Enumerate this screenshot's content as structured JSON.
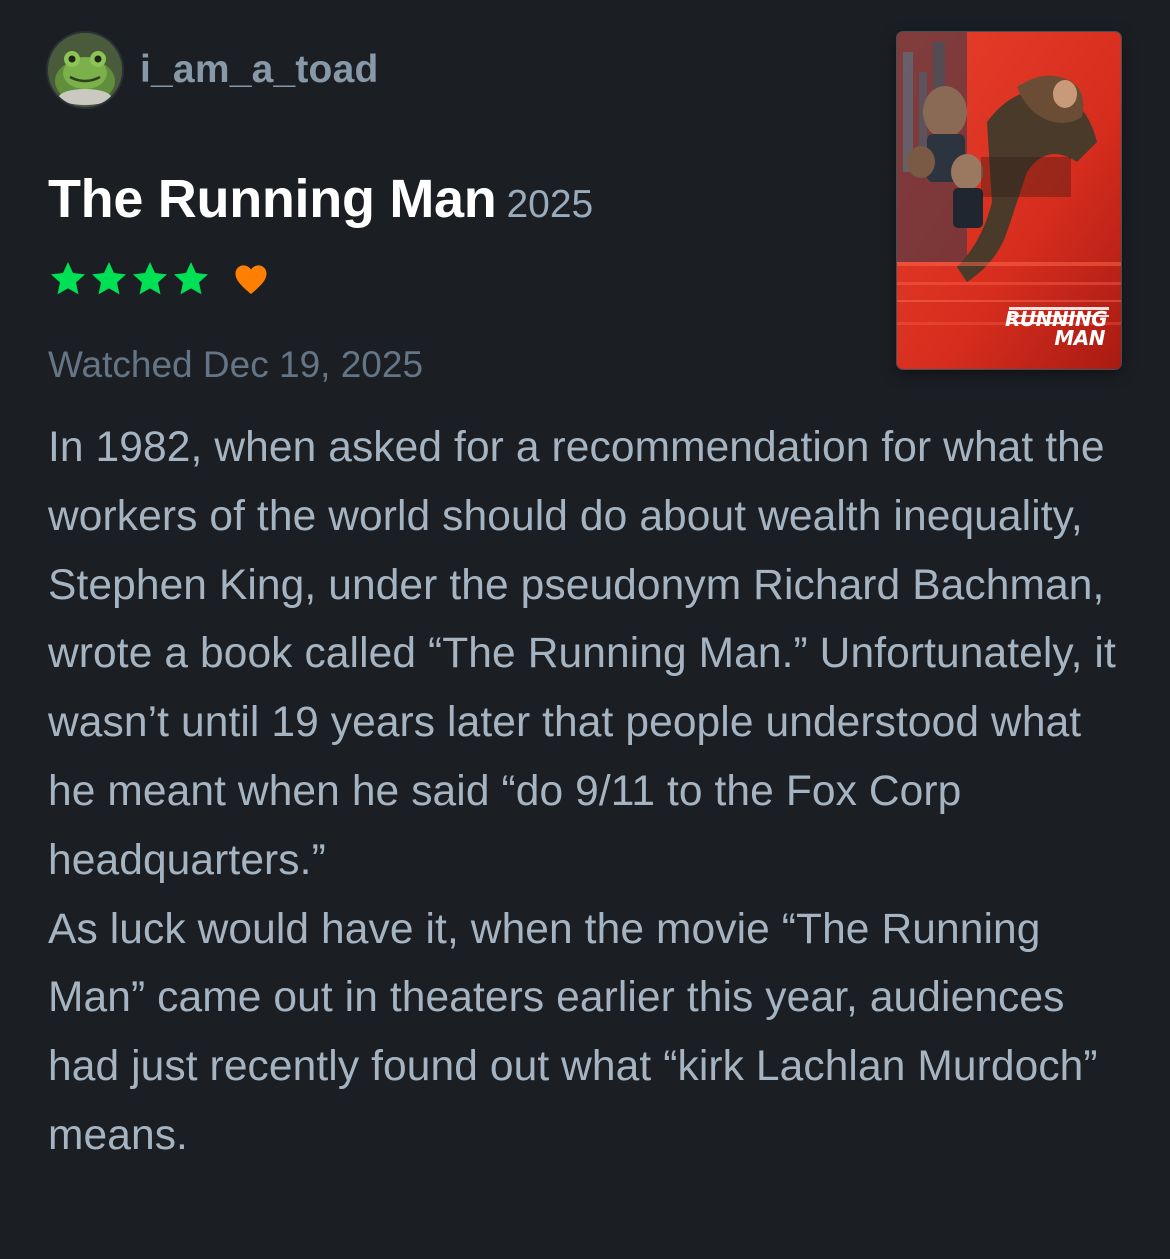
{
  "user": {
    "username": "i_am_a_toad",
    "avatar_icon": "toad-avatar-icon"
  },
  "film": {
    "title": "The Running Man",
    "year": "2025",
    "poster": {
      "logo_line1": "RUNNING",
      "logo_line2": "MAN",
      "background_color": "#d62d1e"
    }
  },
  "rating": {
    "stars": 4,
    "max_stars": 5,
    "star_color": "#00e054",
    "liked": true,
    "heart_color": "#ff8000"
  },
  "watched_label": "Watched Dec 19, 2025",
  "review": {
    "paragraphs": [
      "In 1982, when asked for a recommendation for what the workers of the world should do about wealth inequality, Stephen King, under the pseudonym Richard Bachman, wrote a book called “The Running Man.” Unfortunately, it wasn’t until 19 years later that people understood what he meant when he said “do 9/11 to the Fox Corp headquarters.”",
      "As luck would have it, when the movie “The Running Man” came out in theaters earlier this year, audiences had just recently found out what “kirk Lachlan Murdoch” means."
    ]
  }
}
